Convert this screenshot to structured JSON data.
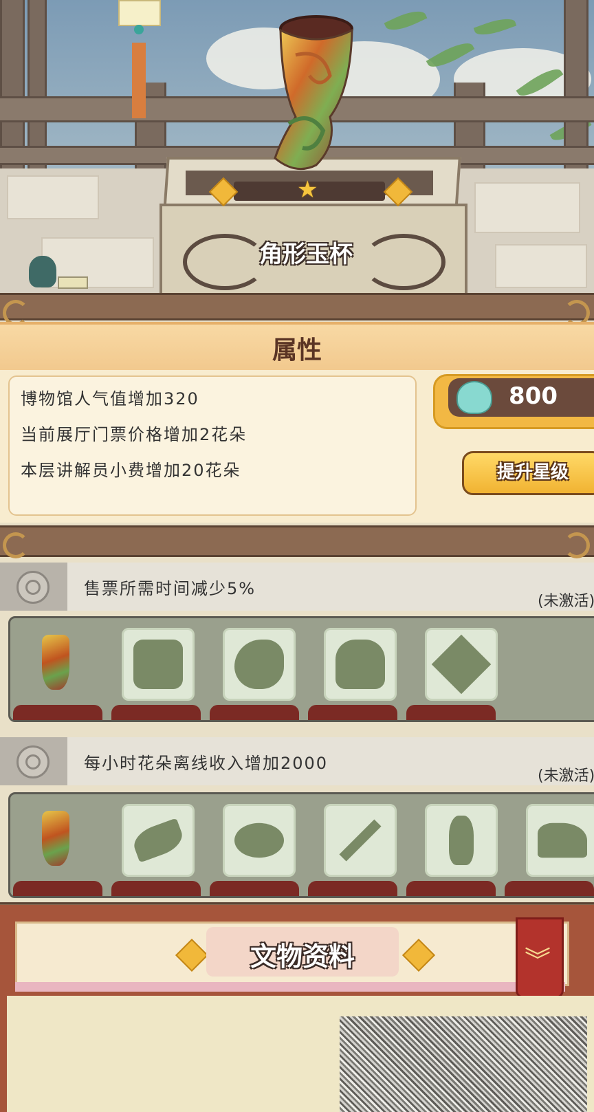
{
  "artifact": {
    "name": "角形玉杯",
    "stars": "★"
  },
  "attributes": {
    "title": "属性",
    "lines": [
      "博物馆人气值增加320",
      "当前展厅门票价格增加2花朵",
      "本层讲解员小费增加20花朵"
    ],
    "cost_value": "800",
    "upgrade_label": "提升星级"
  },
  "sets": [
    {
      "description": "售票所需时间减少5%",
      "status": "(未激活)",
      "slots": [
        "jade-cup",
        "ritual-vessel",
        "bird-vessel",
        "beast-figure",
        "square-tile"
      ]
    },
    {
      "description": "每小时花朵离线收入增加2000",
      "status": "(未激活)",
      "slots": [
        "jade-cup",
        "ruyi-scepter",
        "bronze-bowl",
        "bronze-sword",
        "vase",
        "horse-figure"
      ]
    }
  ],
  "info_panel": {
    "title": "文物资料"
  },
  "colors": {
    "panel": "#f8eccf",
    "header": "#f2c98e",
    "accent": "#f1b332",
    "wood": "#8c6a52",
    "set_row": "#9aa08d",
    "slot_bar": "#7b2a24"
  },
  "icons": {
    "cost": "jelly-creature-icon",
    "set": "ring-emblem-icon",
    "fold": "double-chevron-down-icon"
  }
}
